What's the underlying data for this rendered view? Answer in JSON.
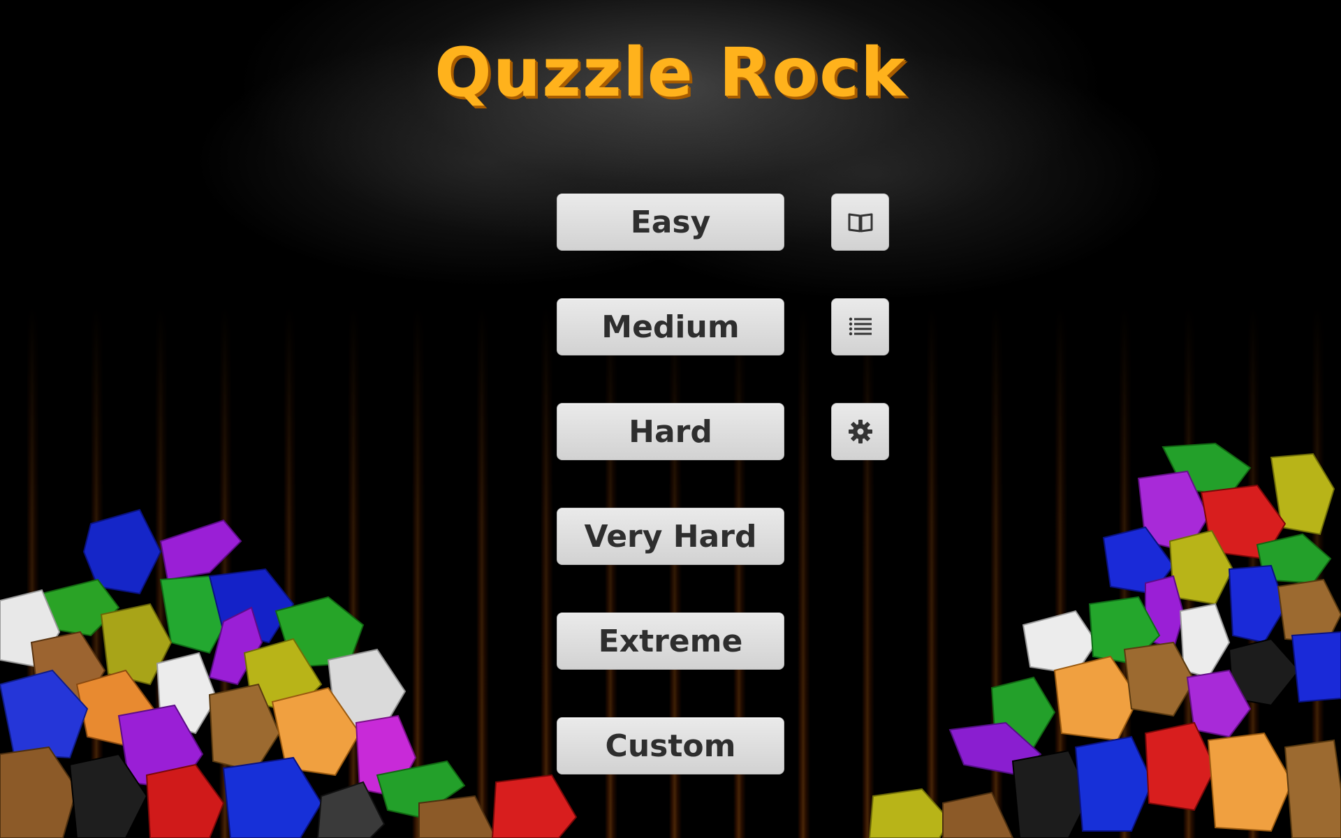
{
  "game": {
    "title": "Quzzle Rock"
  },
  "menu": {
    "easy_label": "Easy",
    "medium_label": "Medium",
    "hard_label": "Hard",
    "very_hard_label": "Very Hard",
    "extreme_label": "Extreme",
    "custom_label": "Custom"
  },
  "side_buttons": [
    {
      "icon": "book-icon"
    },
    {
      "icon": "list-icon"
    },
    {
      "icon": "gear-icon"
    }
  ],
  "colors": {
    "title": "#ffb21c",
    "title_shadow": "#a85c00",
    "button_bg": "#dcdcdc",
    "button_text": "#2e2e2e"
  }
}
